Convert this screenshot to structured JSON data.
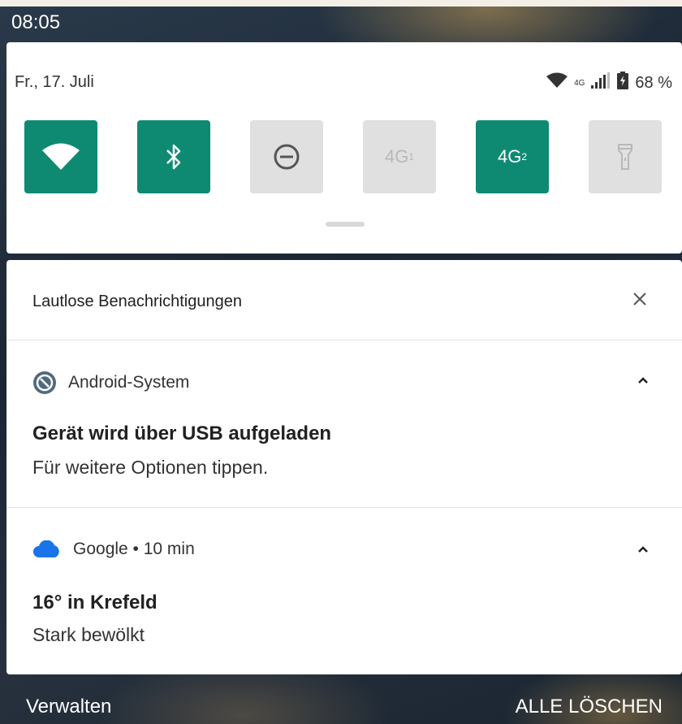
{
  "statusbar": {
    "time": "08:05"
  },
  "quick_settings": {
    "date": "Fr., 17. Juli",
    "network_label": "4G",
    "battery_percent": "68 %",
    "tiles": [
      {
        "name": "wifi",
        "active": true
      },
      {
        "name": "bluetooth",
        "active": true
      },
      {
        "name": "do-not-disturb",
        "active": false
      },
      {
        "name": "sim1-4g",
        "label": "4G",
        "sup": "1",
        "active": false
      },
      {
        "name": "sim2-4g",
        "label": "4G",
        "sup": "2",
        "active": true
      },
      {
        "name": "flashlight",
        "active": false
      }
    ],
    "accent_color": "#0e8a73"
  },
  "notifications": {
    "section_title": "Lautlose Benachrichtigungen",
    "items": [
      {
        "app": "Android-System",
        "title": "Gerät wird über USB aufgeladen",
        "text": "Für weitere Optionen tippen."
      },
      {
        "app": "Google • 10 min",
        "title": "16° in Krefeld",
        "text": "Stark bewölkt"
      }
    ]
  },
  "footer": {
    "manage_label": "Verwalten",
    "clear_all_label": "ALLE LÖSCHEN"
  }
}
